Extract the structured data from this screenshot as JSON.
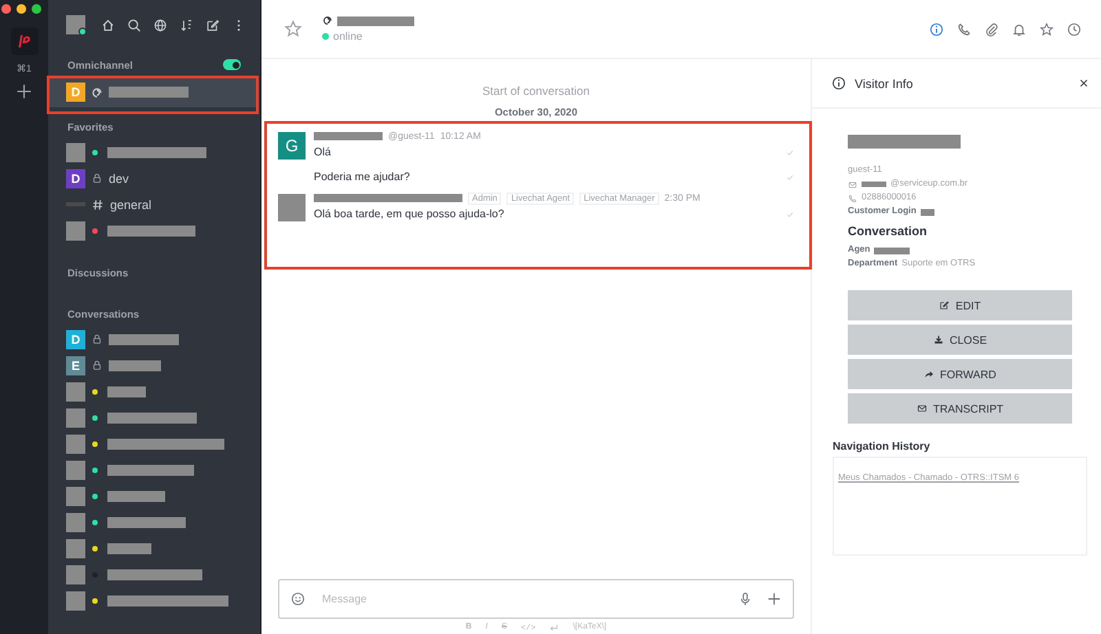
{
  "rail": {
    "shortcut": "⌘1"
  },
  "sidebar": {
    "omnichannel": {
      "title": "Omnichannel",
      "enabled": true,
      "items": [
        {
          "kind": "livechat",
          "avatar": "D",
          "color": "#f5a623",
          "selected": true
        }
      ]
    },
    "favorites": {
      "title": "Favorites",
      "items": [
        {
          "kind": "user",
          "color": "#2de0a5",
          "selected": false
        },
        {
          "kind": "private",
          "avatar": "D",
          "color": "#6e3fc4",
          "name": "dev",
          "selected": false
        },
        {
          "kind": "channel",
          "name": "general",
          "selected": false
        },
        {
          "kind": "user",
          "color": "#f5455c",
          "selected": false
        }
      ]
    },
    "discussions": {
      "title": "Discussions"
    },
    "conversations": {
      "title": "Conversations",
      "items": [
        {
          "kind": "private",
          "avatar": "D",
          "color": "#1eb1d8",
          "selected": false
        },
        {
          "kind": "private",
          "avatar": "E",
          "color": "#5f8b96",
          "selected": false
        },
        {
          "kind": "user",
          "color": "#e8d81f",
          "selected": false
        },
        {
          "kind": "user",
          "color": "#2de0a5",
          "selected": false
        },
        {
          "kind": "user",
          "color": "#e8d81f",
          "selected": false
        },
        {
          "kind": "user",
          "color": "#2de0a5",
          "selected": false
        },
        {
          "kind": "user",
          "color": "#2de0a5",
          "selected": false
        },
        {
          "kind": "user",
          "color": "#2de0a5",
          "selected": false
        },
        {
          "kind": "user",
          "color": "#e8d81f",
          "selected": false
        },
        {
          "kind": "user",
          "color": "#1f2329",
          "selected": false
        },
        {
          "kind": "user",
          "color": "#e8d81f",
          "selected": false
        }
      ]
    }
  },
  "header": {
    "status": "online",
    "actions": [
      {
        "kind": "info",
        "selected": true
      },
      {
        "kind": "phone",
        "selected": false
      },
      {
        "kind": "clip",
        "selected": false
      },
      {
        "kind": "bell",
        "selected": false
      },
      {
        "kind": "star",
        "selected": false
      },
      {
        "kind": "clock",
        "selected": false
      }
    ]
  },
  "chat": {
    "start": "Start of conversation",
    "date": "October 30, 2020",
    "messages": [
      {
        "avatar": "G",
        "color": "#158f83",
        "username": "@guest-11",
        "time": "10:12 AM",
        "lines": [
          "Olá",
          "Poderia me ajudar?"
        ]
      },
      {
        "time": "2:30 PM",
        "roles": [
          "Admin",
          "Livechat Agent",
          "Livechat Manager"
        ],
        "lines": [
          "Olá boa tarde, em que posso ajuda-lo?"
        ]
      }
    ]
  },
  "composer": {
    "placeholder": "Message",
    "format": [
      {
        "kind": "bold",
        "label": "B"
      },
      {
        "kind": "italic",
        "label": "I"
      },
      {
        "kind": "strike",
        "label": "S"
      },
      {
        "kind": "code",
        "label": "</>"
      },
      {
        "kind": "newline"
      },
      {
        "kind": "text",
        "label": "\\[KaTeX\\]"
      }
    ]
  },
  "visitor": {
    "title": "Visitor Info",
    "username": "guest-11",
    "email_domain": "@serviceup.com.br",
    "phone": "02886000016",
    "login_label": "Customer Login",
    "conversation_heading": "Conversation",
    "agent_label": "Agen",
    "department_label": "Department",
    "department": "Suporte em OTRS",
    "buttons": [
      {
        "kind": "edit",
        "label": "EDIT"
      },
      {
        "kind": "close",
        "label": "CLOSE"
      },
      {
        "kind": "forward",
        "label": "FORWARD"
      },
      {
        "kind": "transcript",
        "label": "TRANSCRIPT"
      }
    ],
    "history_title": "Navigation History",
    "history": [
      "Meus Chamados - Chamado - OTRS::ITSM 6"
    ]
  }
}
